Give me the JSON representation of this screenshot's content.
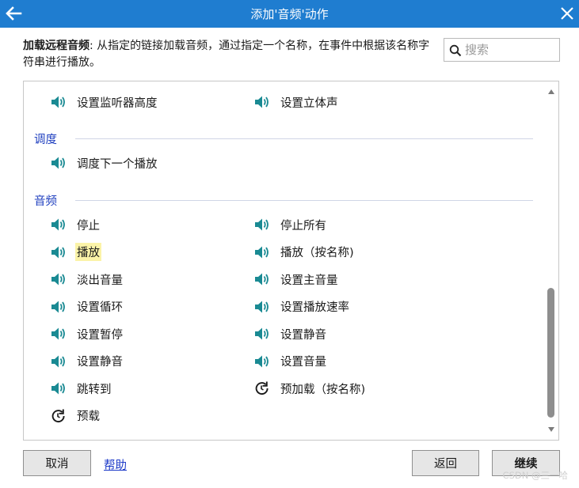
{
  "window": {
    "title": "添加'音频'动作"
  },
  "description": {
    "bold": "加载远程音频",
    "text": ": 从指定的链接加载音频，通过指定一个名称，在事件中根据该名称字符串进行播放。"
  },
  "search": {
    "placeholder": "搜索",
    "value": ""
  },
  "colors": {
    "titlebar": "#1f7dd0",
    "speaker_icon": "#1a8a93",
    "section_label": "#1f3fbf",
    "highlight": "#fbf3a8"
  },
  "top_items": [
    {
      "label": "设置监听器高度",
      "icon": "speaker-icon"
    },
    {
      "label": "设置立体声",
      "icon": "speaker-icon"
    }
  ],
  "sections": [
    {
      "name": "调度",
      "items": [
        {
          "label": "调度下一个播放",
          "icon": "speaker-icon"
        }
      ]
    },
    {
      "name": "音频",
      "items": [
        {
          "label": "停止",
          "icon": "speaker-icon"
        },
        {
          "label": "停止所有",
          "icon": "speaker-icon"
        },
        {
          "label": "播放",
          "icon": "speaker-icon",
          "highlighted": true
        },
        {
          "label": "播放（按名称)",
          "icon": "speaker-icon"
        },
        {
          "label": "淡出音量",
          "icon": "speaker-icon"
        },
        {
          "label": "设置主音量",
          "icon": "speaker-icon"
        },
        {
          "label": "设置循环",
          "icon": "speaker-icon"
        },
        {
          "label": "设置播放速率",
          "icon": "speaker-icon"
        },
        {
          "label": "设置暂停",
          "icon": "speaker-icon"
        },
        {
          "label": "设置静音",
          "icon": "speaker-icon"
        },
        {
          "label": "设置静音",
          "icon": "speaker-icon"
        },
        {
          "label": "设置音量",
          "icon": "speaker-icon"
        },
        {
          "label": "跳转到",
          "icon": "speaker-icon"
        },
        {
          "label": "预加载（按名称)",
          "icon": "reload-icon"
        },
        {
          "label": "预载",
          "icon": "reload-icon"
        }
      ]
    }
  ],
  "footer": {
    "cancel": "取消",
    "help": "帮助",
    "back": "返回",
    "continue": "继续"
  },
  "watermark": "CSDN @三一哈"
}
